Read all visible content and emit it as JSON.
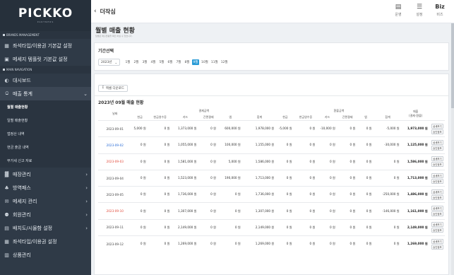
{
  "app": {
    "logo": "PICKKO",
    "logo_sub": "PARTNERS"
  },
  "sidebar": {
    "sections": [
      {
        "label": "BRANDS MANAGEMENT"
      },
      {
        "label": "MAIN NAVIGATION"
      }
    ],
    "brand_items": [
      {
        "label": "좌석타입/이용권 기본값 설정",
        "icon": "grid-icon"
      },
      {
        "label": "메세지 템플릿 기본값 설정",
        "icon": "message-icon"
      }
    ],
    "main_items": [
      {
        "label": "대시보드",
        "icon": "dashboard-icon"
      },
      {
        "label": "매출 통계",
        "icon": "chart-icon"
      }
    ],
    "sub_items": [
      {
        "label": "월별 매출현황"
      },
      {
        "label": "일별 매출현황"
      },
      {
        "label": "앱정산 내역"
      },
      {
        "label": "현금 출금 내역"
      },
      {
        "label": "부가세 신고 자료"
      }
    ],
    "more_items": [
      {
        "label": "매장관리",
        "icon": "store-icon"
      },
      {
        "label": "방역패스",
        "icon": "pass-icon"
      },
      {
        "label": "메세지 관리",
        "icon": "envelope-icon"
      },
      {
        "label": "회원관리",
        "icon": "users-icon"
      },
      {
        "label": "배치도/시물함 설정",
        "icon": "layout-icon"
      },
      {
        "label": "좌석타입/이용권 설정",
        "icon": "grid-icon"
      },
      {
        "label": "상품관리",
        "icon": "product-icon"
      }
    ]
  },
  "topbar": {
    "title": "더작심",
    "items": [
      {
        "label": "운영"
      },
      {
        "label": "설정"
      },
      {
        "label": "비즈",
        "head": "Biz"
      }
    ]
  },
  "page": {
    "title": "월별 매출 현황",
    "desc": "월별로 매출현황을 확인 하실 수 있습니다."
  },
  "period": {
    "title": "기간선택",
    "year": "2023년",
    "months": [
      "1월",
      "2월",
      "3월",
      "4월",
      "5월",
      "6월",
      "7월",
      "8월",
      "9월",
      "10월",
      "11월",
      "12월"
    ],
    "active_month": 8
  },
  "excel_button": "엑셀 다운로드",
  "table": {
    "title": "2023년 09월 매출 현황",
    "group_payment": "결제금액",
    "group_refund": "환불금액",
    "col_date": "날짜",
    "col_sales": "매출",
    "col_sales_sub": "(결제-환불)",
    "sub_headers": [
      "현금",
      "현금영수증",
      "카드",
      "간편결제",
      "앱",
      "합계"
    ],
    "action_labels": [
      "상세보기",
      "승인정보"
    ],
    "rows": [
      {
        "date": "2023-09-01",
        "day": "fri",
        "pay": [
          "5,000 원",
          "0 원",
          "1,373,000 원",
          "0 원",
          "600,000 원",
          "1,978,000 원"
        ],
        "refund": [
          "-5,000 원",
          "0 원",
          "-10,000 원",
          "0 원",
          "0 원",
          "-5,000 원"
        ],
        "sales": "1,973,000 원"
      },
      {
        "date": "2023-09-02",
        "day": "sat",
        "pay": [
          "0 원",
          "0 원",
          "1,055,000 원",
          "0 원",
          "100,000 원",
          "1,155,000 원"
        ],
        "refund": [
          "0 원",
          "0 원",
          "0 원",
          "0 원",
          "0 원",
          "-30,000 원"
        ],
        "sales": "1,125,000 원"
      },
      {
        "date": "2023-09-03",
        "day": "sun",
        "pay": [
          "0 원",
          "0 원",
          "1,581,000 원",
          "0 원",
          "5,000 원",
          "1,586,000 원"
        ],
        "refund": [
          "0 원",
          "0 원",
          "0 원",
          "0 원",
          "0 원",
          "0 원"
        ],
        "sales": "1,586,000 원"
      },
      {
        "date": "2023-09-04",
        "day": "mon",
        "pay": [
          "0 원",
          "0 원",
          "1,523,000 원",
          "0 원",
          "190,000 원",
          "1,713,000 원"
        ],
        "refund": [
          "0 원",
          "0 원",
          "0 원",
          "0 원",
          "0 원",
          "0 원"
        ],
        "sales": "1,713,000 원"
      },
      {
        "date": "2023-09-05",
        "day": "tue",
        "pay": [
          "0 원",
          "0 원",
          "1,736,000 원",
          "0 원",
          "0 원",
          "1,736,000 원"
        ],
        "refund": [
          "0 원",
          "0 원",
          "0 원",
          "0 원",
          "0 원",
          "-250,000 원"
        ],
        "sales": "1,486,000 원"
      },
      {
        "date": "2023-09-10",
        "day": "sun",
        "pay": [
          "0 원",
          "0 원",
          "1,307,000 원",
          "0 원",
          "0 원",
          "1,307,000 원"
        ],
        "refund": [
          "0 원",
          "0 원",
          "0 원",
          "0 원",
          "0 원",
          "-146,000 원"
        ],
        "sales": "1,161,000 원"
      },
      {
        "date": "2023-09-11",
        "day": "mon",
        "pay": [
          "0 원",
          "0 원",
          "2,149,000 원",
          "0 원",
          "0 원",
          "2,149,000 원"
        ],
        "refund": [
          "0 원",
          "0 원",
          "0 원",
          "0 원",
          "0 원",
          "0 원"
        ],
        "sales": "2,149,000 원"
      },
      {
        "date": "2023-09-12",
        "day": "tue",
        "pay": [
          "0 원",
          "0 원",
          "1,269,000 원",
          "0 원",
          "0 원",
          "1,269,000 원"
        ],
        "refund": [
          "0 원",
          "0 원",
          "0 원",
          "0 원",
          "0 원",
          "0 원"
        ],
        "sales": "1,269,000 원"
      }
    ]
  }
}
